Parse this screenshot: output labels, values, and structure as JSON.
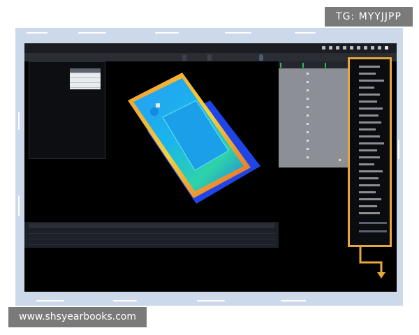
{
  "watermark_tg": "TG: MYYJJPP",
  "watermark_site": "www.shsyearbooks.com",
  "colors": {
    "frame_background": "#cbd9ea",
    "highlight_box": "#e6a83a",
    "screen_background": "#000000",
    "active_tab_green": "#29c24a"
  },
  "app": {
    "toolbar_icons": [
      "save-icon",
      "open-icon",
      "copy-icon",
      "paste-icon",
      "camera-icon",
      "grid-icon",
      "lock-icon",
      "settings-icon",
      "close-icon"
    ],
    "viewport_tabs": [
      "",
      "",
      ""
    ],
    "right_tabs": [
      "",
      "",
      ""
    ],
    "left_table_rows": [
      "",
      "",
      "",
      ""
    ],
    "log_rows": [
      "",
      "",
      "",
      ""
    ],
    "object_render": "3D point cloud heat map of phone frame"
  }
}
